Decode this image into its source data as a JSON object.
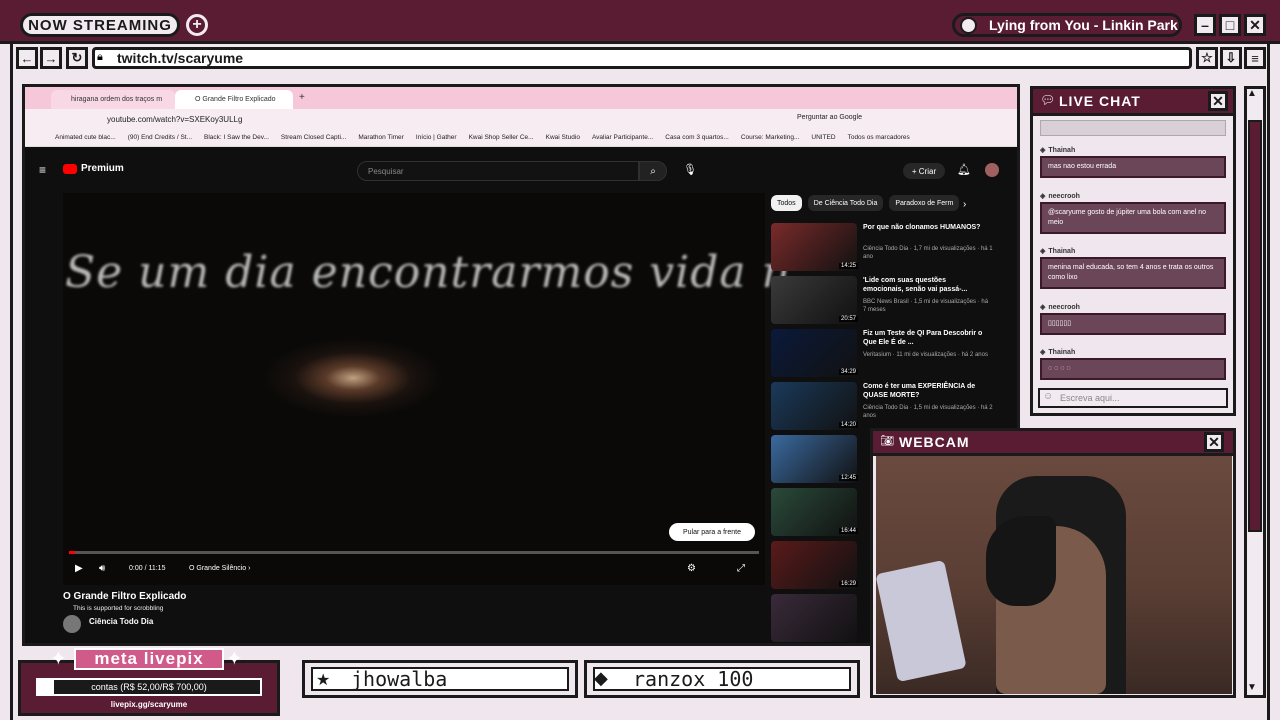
{
  "overlay": {
    "now_streaming": "NOW STREAMING",
    "music": "Lying from You - Linkin Park",
    "url": "twitch.tv/scaryume",
    "live_chat_title": "LIVE CHAT",
    "webcam_title": "WEBCAM",
    "chat_placeholder": "Escreva aqui...",
    "chat_hidden_first": "",
    "chat": [
      {
        "user": "Thainah",
        "text": "mas nao estou errada"
      },
      {
        "user": "neecrooh",
        "text": "@scaryume gosto de júpiter uma bola com anel no meio"
      },
      {
        "user": "Thainah",
        "text": "menina mal educada, so tem 4 anos e trata os outros como lixo"
      },
      {
        "user": "neecrooh",
        "text": "▯▯▯▯▯▯"
      },
      {
        "user": "Thainah",
        "text": "◌ ◌ ◌ ◌"
      }
    ],
    "livepix": {
      "title": "meta livepix",
      "progress_text": "contas (R$ 52,00/R$ 700,00)",
      "progress": 0.074,
      "url": "livepix.gg/scaryume"
    },
    "names": [
      "jhowalba",
      "ranzox",
      "100"
    ]
  },
  "browser": {
    "tabs": [
      "hiragana ordem dos traços m",
      "O Grande Filtro Explicado"
    ],
    "url": "youtube.com/watch?v=SXEKoy3ULLg",
    "ask_google": "Perguntar ao Google",
    "bookmarks": [
      "Animated cute blac...",
      "(90) End Credits / St...",
      "Black: I Saw the Dev...",
      "Stream Closed Capti...",
      "Marathon Timer",
      "Início | Gather",
      "Kwai Shop Seller Ce...",
      "Kwai Studio",
      "Avaliar Participante...",
      "Casa com 3 quartos...",
      "Course: Marketing...",
      "UNITED",
      "Todos os marcadores"
    ]
  },
  "youtube": {
    "logo": "Premium",
    "search_placeholder": "Pesquisar",
    "create": "+ Criar",
    "caption": "Se um dia encontrarmos vida n",
    "time": "0:00 / 11:15",
    "chapter": "O Grande Silêncio ›",
    "skip": "Pular para a frente",
    "title": "O Grande Filtro Explicado",
    "note": "This is supported for scrobbling",
    "channel": "Ciência Todo Dia",
    "chips": [
      "Todos",
      "De Ciência Todo Dia",
      "Paradoxo de Ferm"
    ],
    "recs": [
      {
        "title": "Por que não clonamos HUMANOS?",
        "meta": "Ciência Todo Dia · 1,7 mi de visualizações · há 1 ano",
        "dur": "14:25",
        "color": "#7a2a2a"
      },
      {
        "title": "'Lide com suas questões emocionais, senão vai passá-...",
        "meta": "BBC News Brasil · 1,5 mi de visualizações · há 7 meses",
        "dur": "20:57",
        "color": "#3a3a3a"
      },
      {
        "title": "Fiz um Teste de QI Para Descobrir o Que Ele É de ...",
        "meta": "Veritasium · 11 mi de visualizações · há 2 anos",
        "dur": "34:29",
        "color": "#0a1a3a"
      },
      {
        "title": "Como é ter uma EXPERIÊNCIA de QUASE MORTE?",
        "meta": "Ciência Todo Dia · 1,5 mi de visualizações · há 2 anos",
        "dur": "14:20",
        "color": "#1a3a5a"
      },
      {
        "title": "",
        "meta": "",
        "dur": "12:45",
        "color": "#3a6aa0"
      },
      {
        "title": "",
        "meta": "",
        "dur": "16:44",
        "color": "#2a4a3a"
      },
      {
        "title": "",
        "meta": "",
        "dur": "16:29",
        "color": "#5a1a1a"
      },
      {
        "title": "",
        "meta": "",
        "dur": "",
        "color": "#3a2a3a"
      }
    ]
  }
}
